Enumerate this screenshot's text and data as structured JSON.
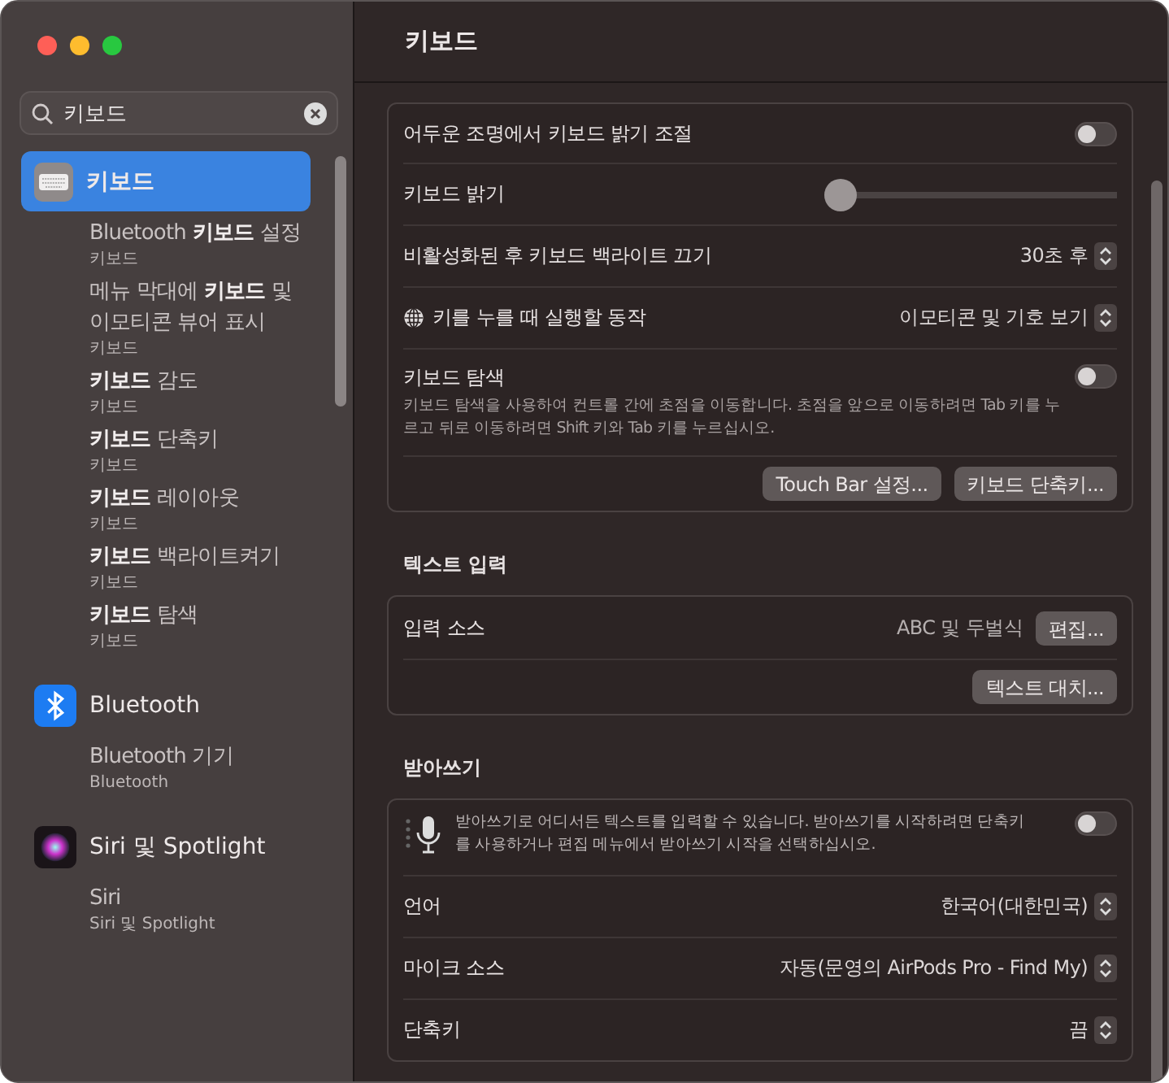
{
  "window": {
    "title": "키보드"
  },
  "search": {
    "value": "키보드"
  },
  "sidebar": {
    "groups": [
      {
        "title": "키보드",
        "selected": true,
        "results": [
          {
            "title": "Bluetooth **키보드** 설정",
            "subtitle": "키보드"
          },
          {
            "title": "메뉴 막대에 **키보드** 및 이모티콘 뷰어 표시",
            "subtitle": "키보드"
          },
          {
            "title": "**키보드** 감도",
            "subtitle": "키보드"
          },
          {
            "title": "**키보드** 단축키",
            "subtitle": "키보드"
          },
          {
            "title": "**키보드** 레이아웃",
            "subtitle": "키보드"
          },
          {
            "title": "**키보드** 백라이트켜기",
            "subtitle": "키보드"
          },
          {
            "title": "**키보드** 탐색",
            "subtitle": "키보드"
          }
        ]
      },
      {
        "title": "Bluetooth",
        "selected": false,
        "results": [
          {
            "title": "Bluetooth 기기",
            "subtitle": "Bluetooth"
          }
        ]
      },
      {
        "title": "Siri 및 Spotlight",
        "selected": false,
        "results": [
          {
            "title": "Siri",
            "subtitle": "Siri 및 Spotlight"
          }
        ]
      }
    ]
  },
  "sections": [
    {
      "rows": [
        {
          "kind": "toggle",
          "label": "어두운 조명에서 키보드 밝기 조절",
          "on": false
        },
        {
          "kind": "slider",
          "label": "키보드 밝기",
          "level": 0
        },
        {
          "kind": "select",
          "label": "비활성화된 후 키보드 백라이트 끄기",
          "value": "30초 후"
        },
        {
          "kind": "select",
          "globe_icon": true,
          "label": "키를 누를 때 실행할 동작",
          "value": "이모티콘 및 기호 보기"
        },
        {
          "kind": "toggle",
          "label": "키보드 탐색",
          "description": "키보드 탐색을 사용하여 컨트롤 간에 초점을 이동합니다. 초점을 앞으로 이동하려면 Tab 키를 누르고 뒤로 이동하려면 Shift 키와 Tab 키를 누르십시오.",
          "on": false
        },
        {
          "kind": "buttons",
          "buttons": [
            "Touch Bar 설정...",
            "키보드 단축키..."
          ]
        }
      ]
    },
    {
      "heading": "텍스트 입력",
      "rows": [
        {
          "kind": "value_button",
          "label": "입력 소스",
          "value": "ABC 및 두벌식",
          "button": "편집..."
        },
        {
          "kind": "buttons",
          "buttons": [
            "텍스트 대치..."
          ]
        }
      ]
    },
    {
      "heading": "받아쓰기",
      "rows": [
        {
          "kind": "info_toggle",
          "text": "받아쓰기로 어디서든 텍스트를 입력할 수 있습니다. 받아쓰기를 시작하려면 단축키를 사용하거나 편집 메뉴에서 받아쓰기 시작을 선택하십시오.",
          "on": false
        },
        {
          "kind": "select",
          "label": "언어",
          "value": "한국어(대한민국)"
        },
        {
          "kind": "select",
          "label": "마이크 소스",
          "value": "자동(문영의 AirPods Pro - Find My)"
        },
        {
          "kind": "select",
          "label": "단축키",
          "value": "끔"
        }
      ]
    }
  ]
}
